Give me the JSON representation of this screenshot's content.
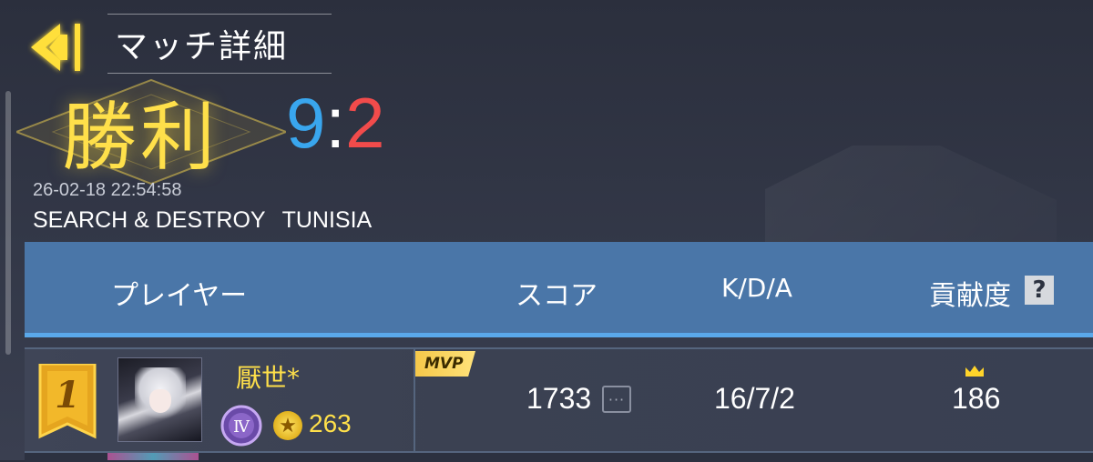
{
  "header": {
    "title": "マッチ詳細",
    "back_icon": "back-arrow-icon"
  },
  "result": {
    "label": "勝利",
    "score_blue": "9",
    "score_separator": ":",
    "score_red": "2",
    "datetime": "26-02-18 22:54:58",
    "mode": "SEARCH & DESTROY",
    "map": "TUNISIA"
  },
  "table": {
    "columns": {
      "player": "プレイヤー",
      "score": "スコア",
      "kda": "K/D/A",
      "contribution": "貢献度",
      "help": "?"
    },
    "rows": [
      {
        "rank": "1",
        "name": "厭世*",
        "rank_tier": "Ⅳ",
        "points": "263",
        "mvp": "MVP",
        "score": "1733",
        "more": "···",
        "kda": "16/7/2",
        "contribution": "186"
      }
    ]
  },
  "colors": {
    "accent_yellow": "#ffe04a",
    "blue_team": "#39a6ee",
    "red_team": "#f14b4b",
    "header_bar": "#4a76a8"
  }
}
